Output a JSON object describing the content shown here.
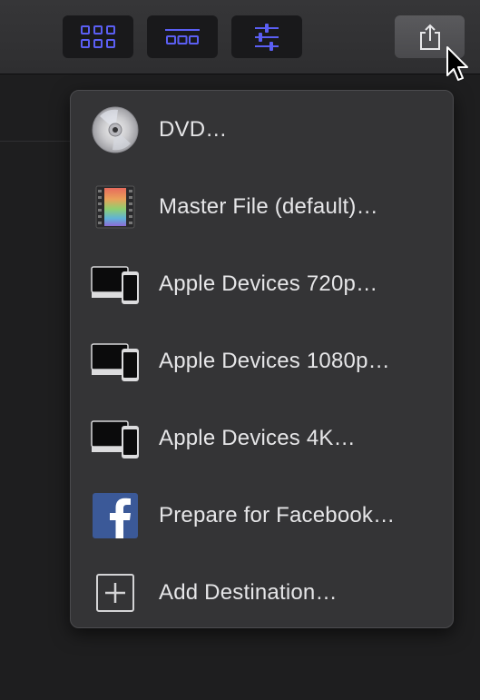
{
  "toolbar": {
    "buttons": [
      {
        "icon": "grid-view-icon"
      },
      {
        "icon": "filmstrip-view-icon"
      },
      {
        "icon": "adjustments-sliders-icon"
      }
    ],
    "share_icon": "share-icon",
    "accent_color": "#5b5ff4"
  },
  "share_menu": {
    "items": [
      {
        "label": "DVD…",
        "icon": "dvd-disc-icon"
      },
      {
        "label": "Master File (default)…",
        "icon": "film-strip-icon"
      },
      {
        "label": "Apple Devices 720p…",
        "icon": "apple-devices-icon"
      },
      {
        "label": "Apple Devices 1080p…",
        "icon": "apple-devices-icon"
      },
      {
        "label": "Apple Devices 4K…",
        "icon": "apple-devices-icon"
      },
      {
        "label": "Prepare for Facebook…",
        "icon": "facebook-icon"
      },
      {
        "label": "Add Destination…",
        "icon": "add-square-icon"
      }
    ]
  }
}
